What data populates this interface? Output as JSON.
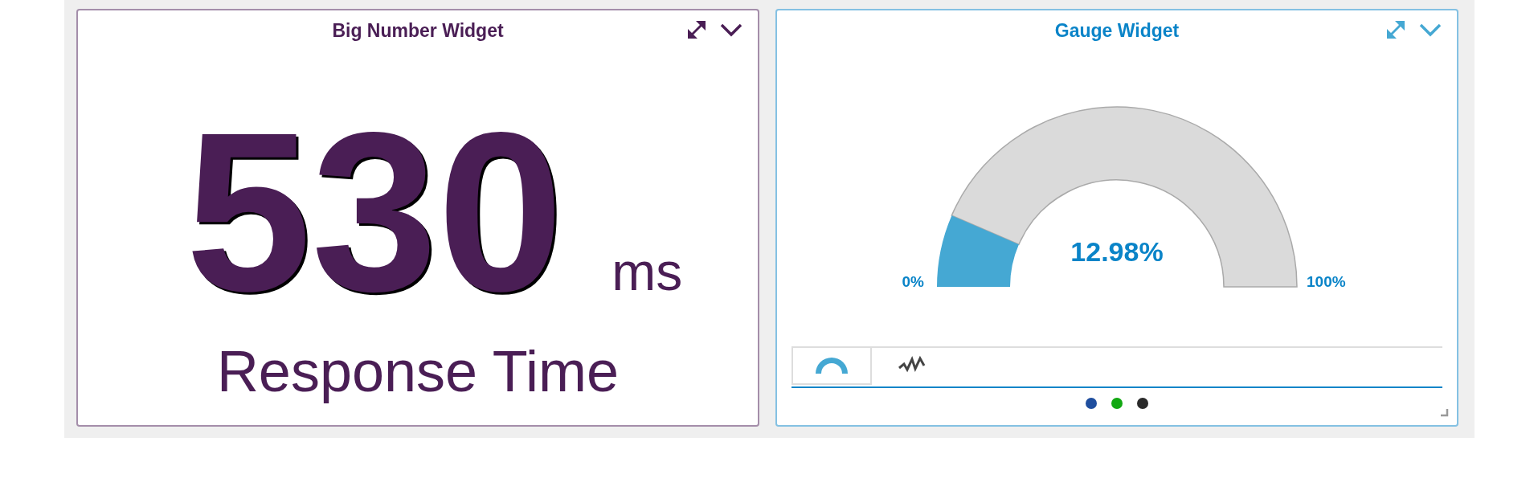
{
  "widgets": [
    {
      "kind": "big_number",
      "title": "Big Number Widget",
      "color": "#4a1e55",
      "value": "530",
      "unit": "ms",
      "label": "Response Time"
    },
    {
      "kind": "gauge",
      "title": "Gauge Widget",
      "color": "#0a84c8",
      "value": "12.98%",
      "min_label": "0%",
      "max_label": "100%",
      "tabs": [
        {
          "kind": "gauge",
          "selected": true
        },
        {
          "kind": "trend",
          "selected": false
        }
      ],
      "dots": [
        {
          "color": "#1f4e9e"
        },
        {
          "color": "#12a812"
        },
        {
          "color": "#2a2a2a"
        }
      ]
    }
  ]
}
